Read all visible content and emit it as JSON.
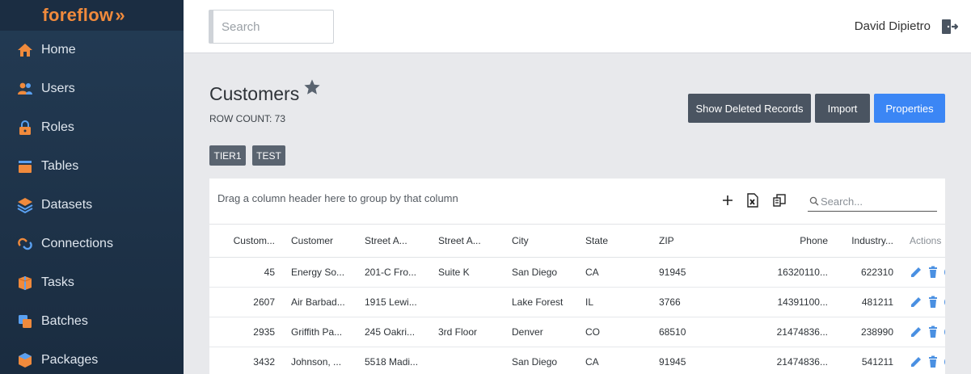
{
  "app": {
    "logo_text": "foreflow",
    "logo_mark": "»"
  },
  "sidebar": {
    "items": [
      {
        "label": "Home",
        "icon": "home-icon"
      },
      {
        "label": "Users",
        "icon": "users-icon"
      },
      {
        "label": "Roles",
        "icon": "lock-icon"
      },
      {
        "label": "Tables",
        "icon": "tables-icon"
      },
      {
        "label": "Datasets",
        "icon": "layers-icon"
      },
      {
        "label": "Connections",
        "icon": "link-icon"
      },
      {
        "label": "Tasks",
        "icon": "box-icon"
      },
      {
        "label": "Batches",
        "icon": "batches-icon"
      },
      {
        "label": "Packages",
        "icon": "package-icon"
      }
    ]
  },
  "topbar": {
    "search_placeholder": "Search",
    "user_name": "David Dipietro"
  },
  "page": {
    "title": "Customers",
    "row_count": "ROW COUNT: 73",
    "buttons": {
      "show_deleted": "Show Deleted Records",
      "import": "Import",
      "properties": "Properties"
    },
    "tags": [
      "TIER1",
      "TEST"
    ]
  },
  "grid": {
    "group_hint": "Drag a column header here to group by that column",
    "search_placeholder": "Search...",
    "columns": [
      "Custom...",
      "Customer",
      "Street A...",
      "Street A...",
      "City",
      "State",
      "ZIP",
      "Phone",
      "Industry...",
      "Actions"
    ],
    "rows": [
      [
        "45",
        "Energy So...",
        "201-C Fro...",
        "Suite K",
        "San Diego",
        "CA",
        "91945",
        "16320110...",
        "622310"
      ],
      [
        "2607",
        "Air Barbad...",
        "1915 Lewi...",
        "",
        "Lake Forest",
        "IL",
        "3766",
        "14391100...",
        "481211"
      ],
      [
        "2935",
        "Griffith Pa...",
        "245 Oakri...",
        "3rd Floor",
        "Denver",
        "CO",
        "68510",
        "21474836...",
        "238990"
      ],
      [
        "3432",
        "Johnson, ...",
        "5518 Madi...",
        "",
        "San Diego",
        "CA",
        "91945",
        "21474836...",
        "541211"
      ]
    ]
  },
  "colors": {
    "accent_orange": "#f08a3c",
    "primary_blue": "#3b86f5",
    "action_icon_blue": "#4a90e2",
    "sidebar_bg": "#1f344b"
  }
}
